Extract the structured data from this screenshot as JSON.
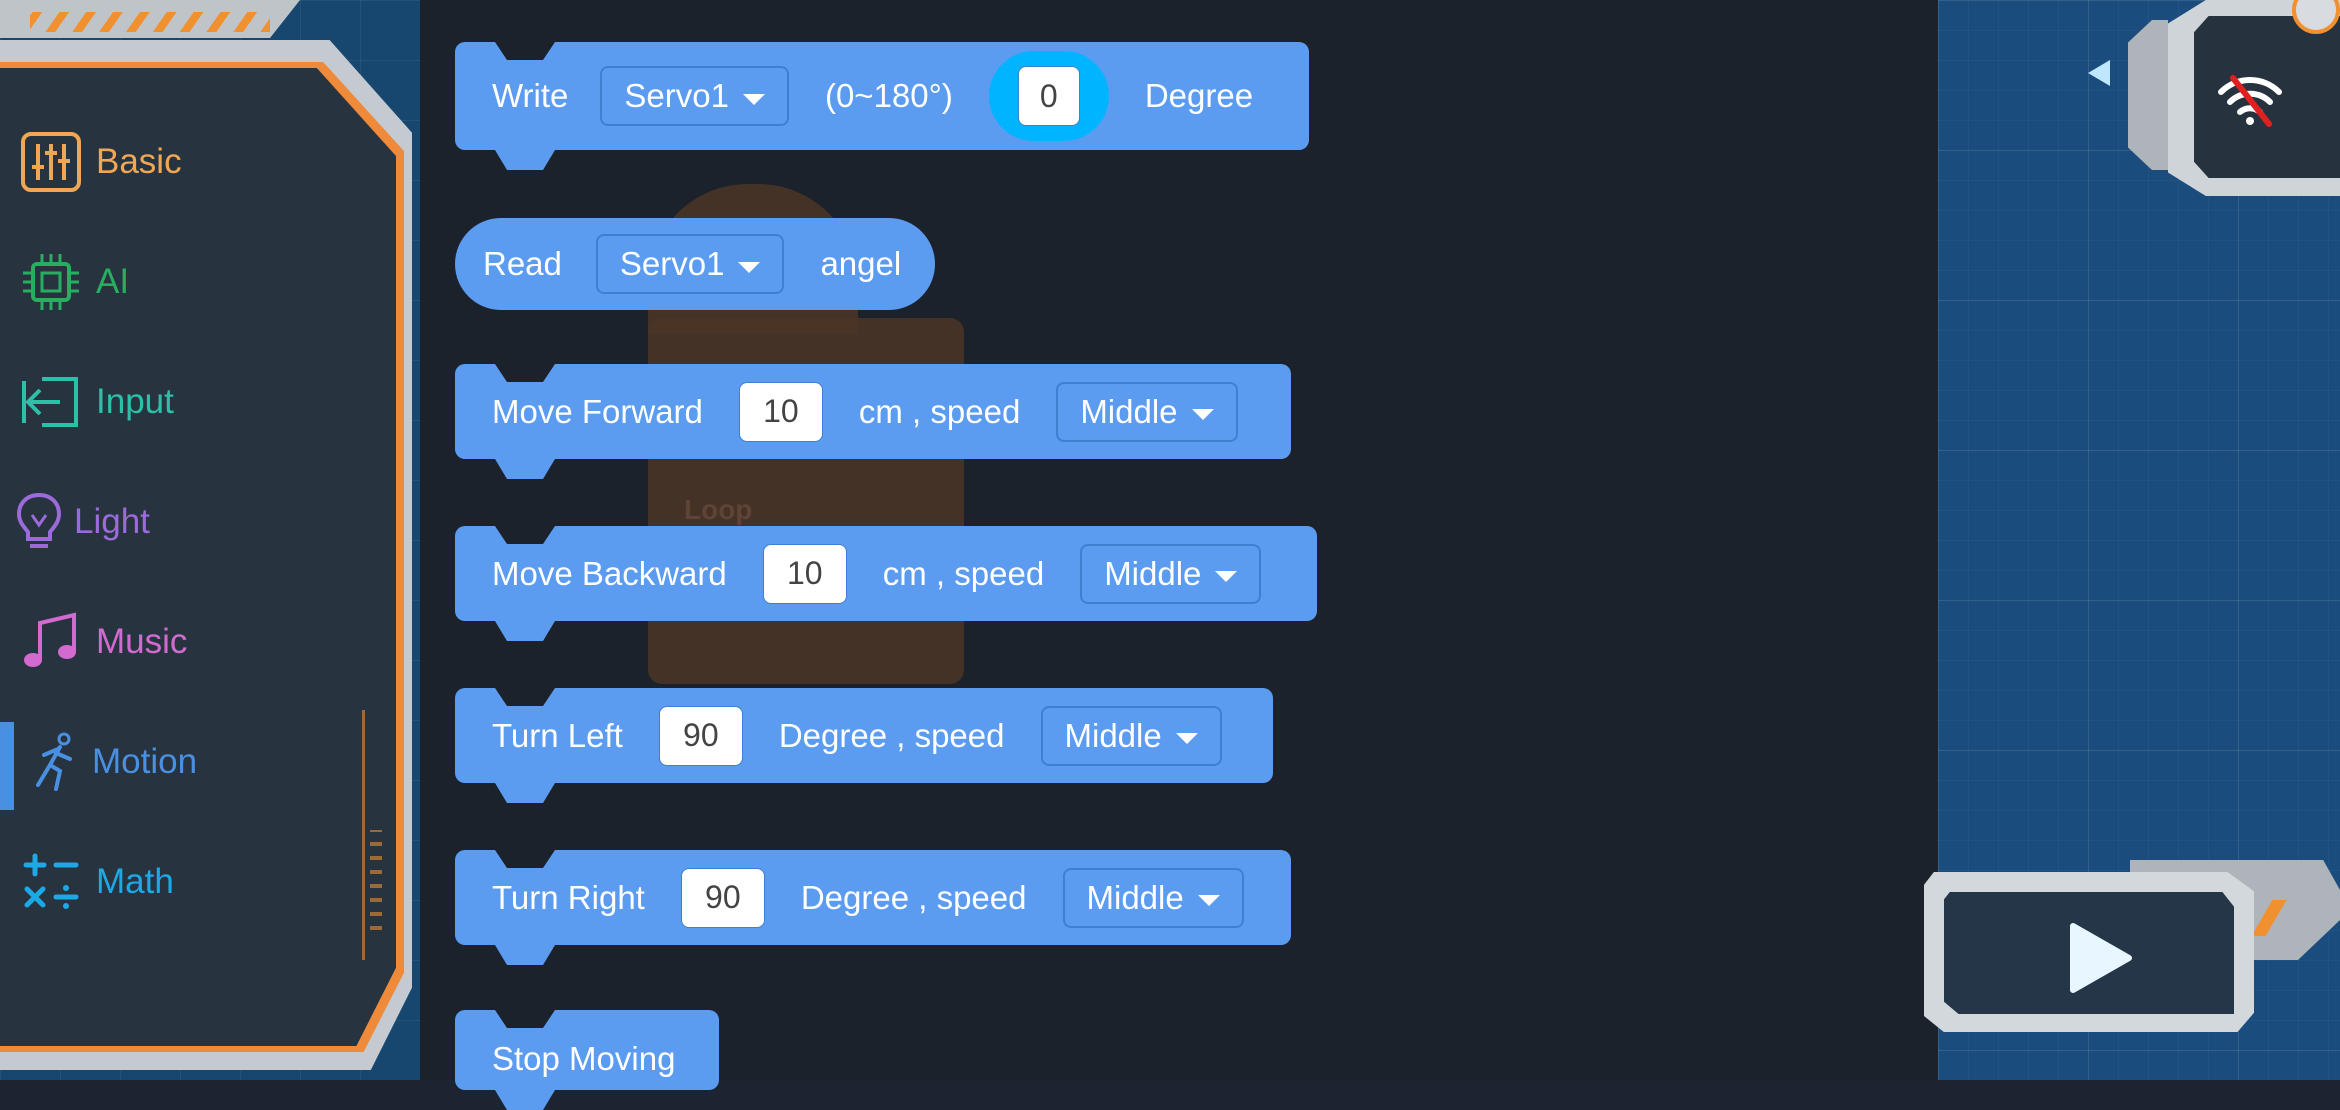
{
  "categories": [
    {
      "label": "Basic",
      "icon": "sliders-icon",
      "color": "#f0a653"
    },
    {
      "label": "AI",
      "icon": "chip-icon",
      "color": "#27ae60"
    },
    {
      "label": "Input",
      "icon": "input-arrow-icon",
      "color": "#2cc0a8"
    },
    {
      "label": "Light",
      "icon": "lightbulb-icon",
      "color": "#9b6bdc"
    },
    {
      "label": "Music",
      "icon": "music-note-icon",
      "color": "#d36ad0"
    },
    {
      "label": "Motion",
      "icon": "running-person-icon",
      "color": "#4a90e2"
    },
    {
      "label": "Math",
      "icon": "math-operators-icon",
      "color": "#1ca9e6"
    }
  ],
  "active_category": "Motion",
  "ghost_block_label": "Loop",
  "blocks": {
    "write_servo": {
      "label": "Write",
      "servo": "Servo1",
      "range": "(0~180°)",
      "value": "0",
      "unit": "Degree"
    },
    "read_servo": {
      "label": "Read",
      "servo": "Servo1",
      "suffix": "angel"
    },
    "move_forward": {
      "label": "Move Forward",
      "value": "10",
      "unit": "cm , speed",
      "speed": "Middle"
    },
    "move_backward": {
      "label": "Move Backward",
      "value": "10",
      "unit": "cm , speed",
      "speed": "Middle"
    },
    "turn_left": {
      "label": "Turn Left",
      "value": "90",
      "unit": "Degree , speed",
      "speed": "Middle"
    },
    "turn_right": {
      "label": "Turn Right",
      "value": "90",
      "unit": "Degree , speed",
      "speed": "Middle"
    },
    "stop_moving": {
      "label": "Stop Moving"
    }
  },
  "colors": {
    "block": "#5b9cf0",
    "accent_orange": "#f0902e",
    "workspace": "#1a4d7d",
    "wifi_off": "#e02020"
  },
  "icons": {
    "wifi_status": "wifi-off-icon",
    "run": "play-icon",
    "collapse": "triangle-left-icon"
  }
}
